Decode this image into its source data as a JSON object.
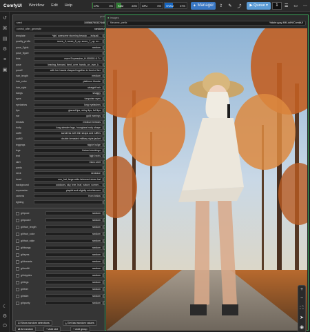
{
  "app": {
    "brand": "ComfyUI",
    "menu": [
      "Workflow",
      "Edit",
      "Help"
    ]
  },
  "stats": [
    {
      "label": "CPU",
      "value": "3%",
      "level": 0.03
    },
    {
      "label": "RAM",
      "value": "23%",
      "level": 0.23
    },
    {
      "label": "GPU",
      "value": "0%",
      "level": 0.0
    },
    {
      "label": "VRAM",
      "value": "37%",
      "level": 0.37
    }
  ],
  "toolbar": {
    "manager_label": "Manager",
    "queue_label": "Queue",
    "queue_count": "1"
  },
  "prompt_node": {
    "title": "prompt",
    "seed_label": "seed",
    "seed_value": "1055687503374489",
    "control_label": "control_after_generate",
    "control_value": "randomize",
    "rows": [
      {
        "k": "template",
        "v": "*girl, awesome stunning beauty, __in/quali...",
        "on": true
      },
      {
        "k": "quality_prefix",
        "v": "score_9, score_8_up, score_7_up, sc...",
        "on": true
      },
      {
        "k": "pose_2girls",
        "v": "random",
        "on": false
      },
      {
        "k": "pose_figure",
        "v": "",
        "on": false
      },
      {
        "k": "tints",
        "v": "more Expressive_H-000001:0.7>",
        "on": true
      },
      {
        "k": "pose",
        "v": "leaning_forward, bent_over, hands_on_own_k...",
        "on": true
      },
      {
        "k": "pose2",
        "v": "with her hands clasped together in front of her",
        "on": true
      },
      {
        "k": "hair_length",
        "v": "medium",
        "on": true
      },
      {
        "k": "hair_color",
        "v": "platinum blonde",
        "on": true
      },
      {
        "k": "hair_style",
        "v": "straight hair",
        "on": true
      },
      {
        "k": "bangs",
        "v": "shaggy",
        "on": true
      },
      {
        "k": "eyes",
        "v": "turquoise eyes",
        "on": true
      },
      {
        "k": "eyelashes",
        "v": "long eyelashes",
        "on": true
      },
      {
        "k": "lips",
        "v": "glazed lips, shiny lips, full lips",
        "on": true
      },
      {
        "k": "ear",
        "v": "gold earrings",
        "on": true
      },
      {
        "k": "breasts",
        "v": "medium breasts",
        "on": true
      },
      {
        "k": "body",
        "v": "long slender legs, hourglass body shape",
        "on": true
      },
      {
        "k": "outfit",
        "v": "sundress with thin straps and ruffles",
        "on": true
      },
      {
        "k": "outfit2",
        "v": "double-breasted military-style jacket",
        "on": true
      },
      {
        "k": "leggings",
        "v": "nipple bulge",
        "on": true
      },
      {
        "k": "legs",
        "v": "fishnet stockings",
        "on": true
      },
      {
        "k": "feet",
        "v": "high heels",
        "on": true
      },
      {
        "k": "skirt",
        "v": "micro skirt",
        "on": true
      },
      {
        "k": "panty",
        "v": "",
        "on": false
      },
      {
        "k": "neck",
        "v": "necklace",
        "on": true
      },
      {
        "k": "head",
        "v": "sun_hat, large wide-brimmed straw hat",
        "on": true
      },
      {
        "k": "background",
        "v": "outdoors, sky, tree, leaf, nature, scener...",
        "on": true
      },
      {
        "k": "expression",
        "v": "playful and slightly mischievous",
        "on": true
      },
      {
        "k": "camera",
        "v": "from below",
        "on": true
      },
      {
        "k": "lighting",
        "v": "",
        "on": false
      }
    ],
    "checks": [
      {
        "k": "girlpose",
        "v": "random"
      },
      {
        "k": "girlpose2",
        "v": "random"
      },
      {
        "k": "girlhair_length",
        "v": "random"
      },
      {
        "k": "girlhair_color",
        "v": "random"
      },
      {
        "k": "girlhair_style",
        "v": "random"
      },
      {
        "k": "girlbangs",
        "v": "random"
      },
      {
        "k": "girleyes",
        "v": "random"
      },
      {
        "k": "girlbreasts",
        "v": "random"
      },
      {
        "k": "girloutfit",
        "v": "random"
      },
      {
        "k": "girlnipples",
        "v": "random"
      },
      {
        "k": "girllegs",
        "v": "random"
      },
      {
        "k": "girlfeet",
        "v": "random"
      },
      {
        "k": "girlskirt",
        "v": "random"
      },
      {
        "k": "girlpanty",
        "v": "random"
      }
    ],
    "show_random_label": "Show random selections",
    "get_last_label": "Get last random values",
    "all_random_label": "All random",
    "add_slot_label": "Add slot",
    "add_group_label": "Add group"
  },
  "image_node": {
    "title": "Images",
    "field_label": "filename_prefix",
    "field_value": "%date:yyyy-MM-dd%/ComfyUI"
  }
}
